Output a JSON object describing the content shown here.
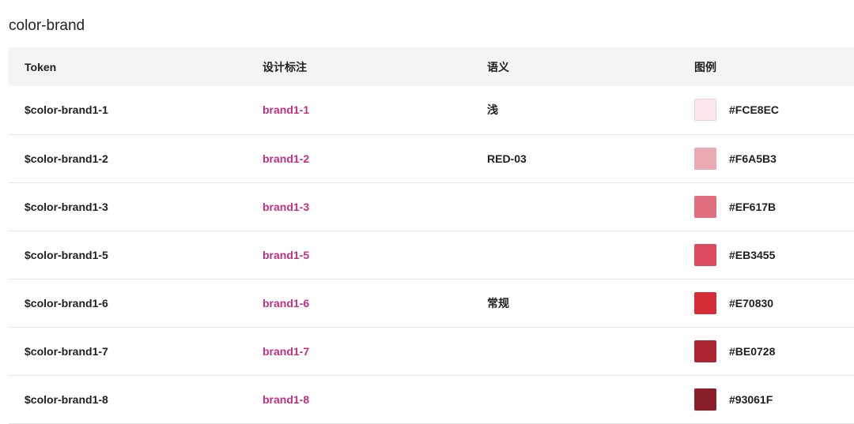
{
  "section": {
    "title": "color-brand"
  },
  "table": {
    "headers": {
      "token": "Token",
      "mark": "设计标注",
      "semantic": "语义",
      "legend": "图例"
    },
    "rows": [
      {
        "token": "$color-brand1-1",
        "mark": "brand1-1",
        "semantic": "浅",
        "hex": "#FCE8EC",
        "color": "#FCE8EC"
      },
      {
        "token": "$color-brand1-2",
        "mark": "brand1-2",
        "semantic": "RED-03",
        "hex": "#F6A5B3",
        "color": "#EAA9B3"
      },
      {
        "token": "$color-brand1-3",
        "mark": "brand1-3",
        "semantic": "",
        "hex": "#EF617B",
        "color": "#E06E7E"
      },
      {
        "token": "$color-brand1-5",
        "mark": "brand1-5",
        "semantic": "",
        "hex": "#EB3455",
        "color": "#DE4A5E"
      },
      {
        "token": "$color-brand1-6",
        "mark": "brand1-6",
        "semantic": "常规",
        "hex": "#E70830",
        "color": "#D42E38"
      },
      {
        "token": "$color-brand1-7",
        "mark": "brand1-7",
        "semantic": "",
        "hex": "#BE0728",
        "color": "#AE2532"
      },
      {
        "token": "$color-brand1-8",
        "mark": "brand1-8",
        "semantic": "",
        "hex": "#93061F",
        "color": "#8A1F29"
      }
    ]
  },
  "colors": {
    "mark_text": "#C42F83",
    "header_bg": "#F3F4F6"
  }
}
